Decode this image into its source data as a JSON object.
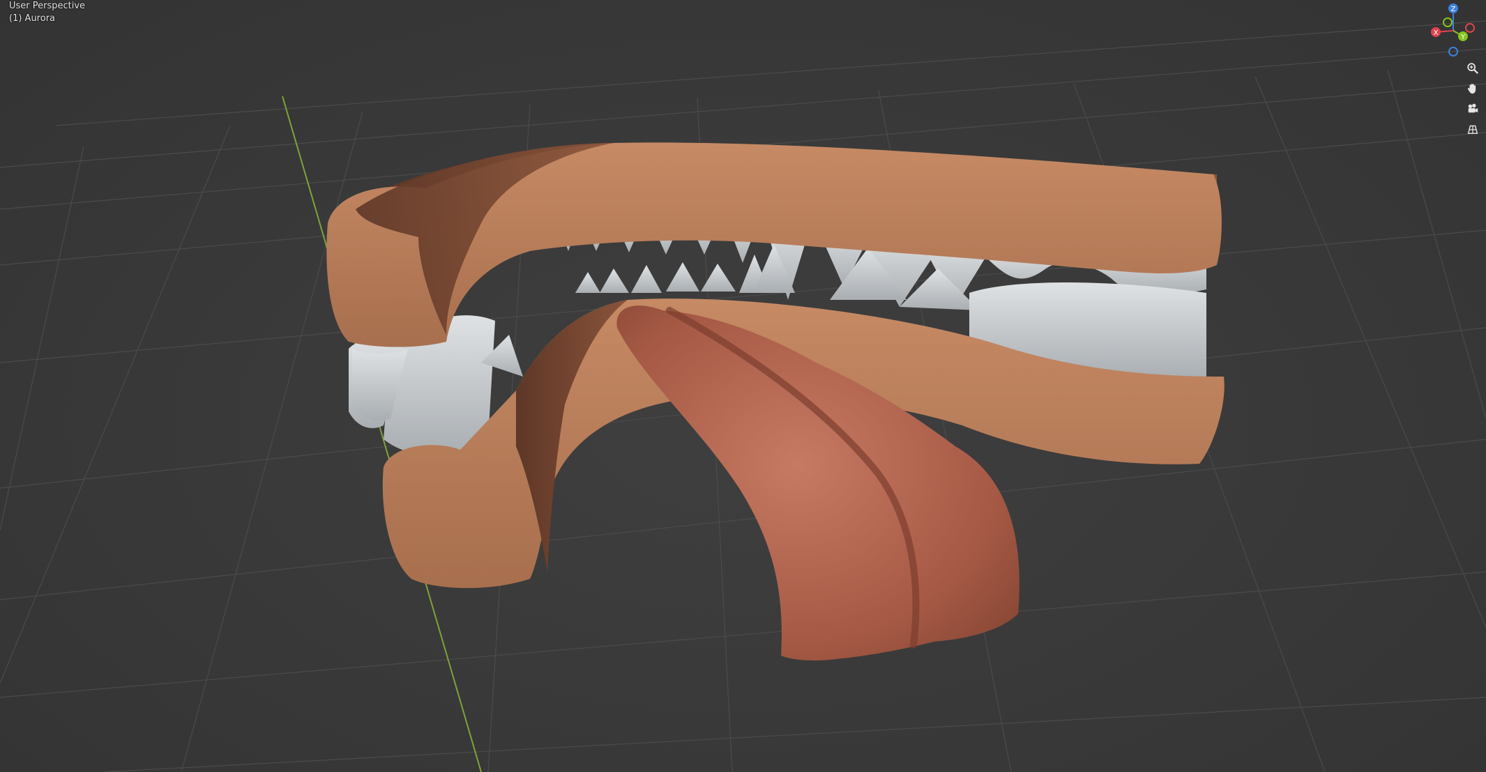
{
  "viewport": {
    "view_name": "User Perspective",
    "active_object": "(1) Aurora"
  },
  "gizmo": {
    "axis_z": "Z",
    "axis_y": "Y",
    "axis_x": "X",
    "color_x": "#e0434f",
    "color_y": "#86c51c",
    "color_z": "#3c82e0"
  },
  "nav_tools": [
    {
      "name": "zoom",
      "icon": "zoom-icon"
    },
    {
      "name": "pan",
      "icon": "hand-icon"
    },
    {
      "name": "camera",
      "icon": "camera-icon"
    },
    {
      "name": "ortho",
      "icon": "grid-icon"
    }
  ],
  "colors": {
    "background": "#393939",
    "grid": "#4a4a4a",
    "y_axis_line": "#7fa23a",
    "gum": "#b9805c",
    "gum_dark": "#7a4a34",
    "tooth": "#c7cbce",
    "tongue": "#b0644e"
  }
}
